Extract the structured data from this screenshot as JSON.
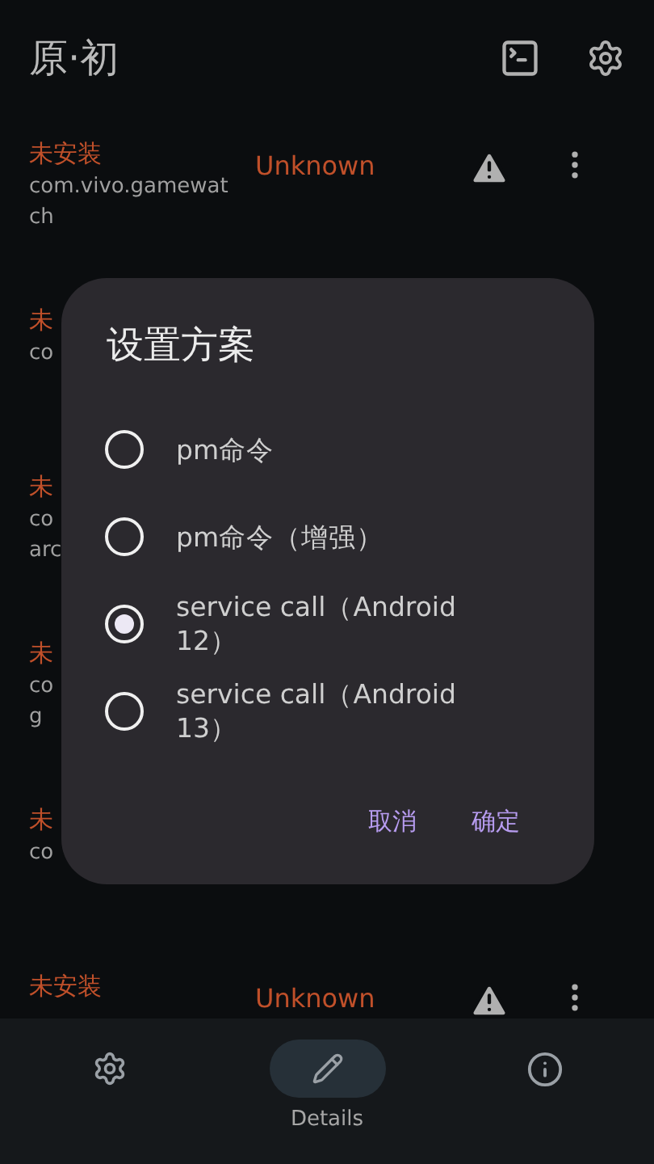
{
  "app_bar": {
    "title": "原·初"
  },
  "packages": [
    {
      "status": "未安装",
      "package_lines": [
        "com.vivo.gamewat",
        "ch"
      ],
      "state": "Unknown"
    },
    {
      "status": "未",
      "package_lines": [
        "co"
      ]
    },
    {
      "status": "未",
      "package_lines": [
        "co",
        "arc"
      ]
    },
    {
      "status": "未",
      "package_lines": [
        "co",
        "g"
      ]
    },
    {
      "status": "未",
      "package_lines": [
        "co"
      ]
    },
    {
      "status": "未安装",
      "state": "Unknown"
    }
  ],
  "dialog": {
    "title": "设置方案",
    "options": [
      {
        "label": "pm命令",
        "selected": false
      },
      {
        "label": "pm命令（增强）",
        "selected": false
      },
      {
        "label": "service call（Android 12）",
        "selected": true
      },
      {
        "label": "service call（Android 13）",
        "selected": false
      }
    ],
    "buttons": [
      "取消",
      "确定"
    ]
  },
  "bottom_nav": [
    {
      "kind": "settings",
      "selected": false
    },
    {
      "kind": "edit",
      "label": "Details",
      "selected": true
    },
    {
      "kind": "info",
      "selected": false
    }
  ]
}
